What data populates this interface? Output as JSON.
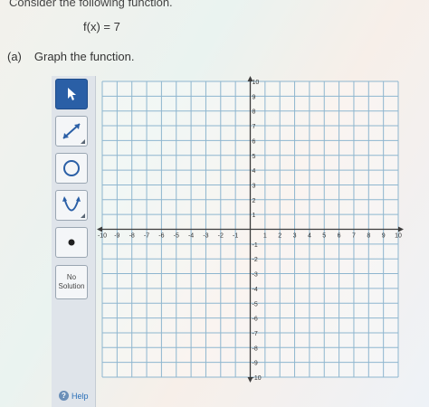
{
  "problem": {
    "prompt": "Consider the following function.",
    "function_text": "f(x) = 7",
    "part_label": "(a)",
    "part_text": "Graph the function."
  },
  "toolbar": {
    "tools": [
      {
        "name": "pointer",
        "icon": "arrow-pointer-icon",
        "active": true
      },
      {
        "name": "line",
        "icon": "line-tool-icon",
        "active": false
      },
      {
        "name": "circle",
        "icon": "circle-tool-icon",
        "active": false
      },
      {
        "name": "parabola",
        "icon": "parabola-tool-icon",
        "active": false
      },
      {
        "name": "point",
        "icon": "point-tool-icon",
        "active": false
      }
    ],
    "no_solution_line1": "No",
    "no_solution_line2": "Solution",
    "help_label": "Help"
  },
  "graph": {
    "x_ticks": [
      "-10",
      "-9",
      "-8",
      "-7",
      "-6",
      "-5",
      "-4",
      "-3",
      "-2",
      "-1",
      "1",
      "2",
      "3",
      "4",
      "5",
      "6",
      "7",
      "8",
      "9",
      "10"
    ],
    "y_ticks": [
      "10",
      "9",
      "8",
      "7",
      "6",
      "5",
      "4",
      "3",
      "2",
      "1",
      "-1",
      "-2",
      "-3",
      "-4",
      "-5",
      "-6",
      "-7",
      "-8",
      "-9",
      "-10"
    ],
    "x_range": [
      -10,
      10
    ],
    "y_range": [
      -10,
      10
    ],
    "grid": true,
    "colors": {
      "grid": "#8eb6cf",
      "axis": "#3c3c3c",
      "toolbar_active": "#2a5fa6"
    }
  }
}
